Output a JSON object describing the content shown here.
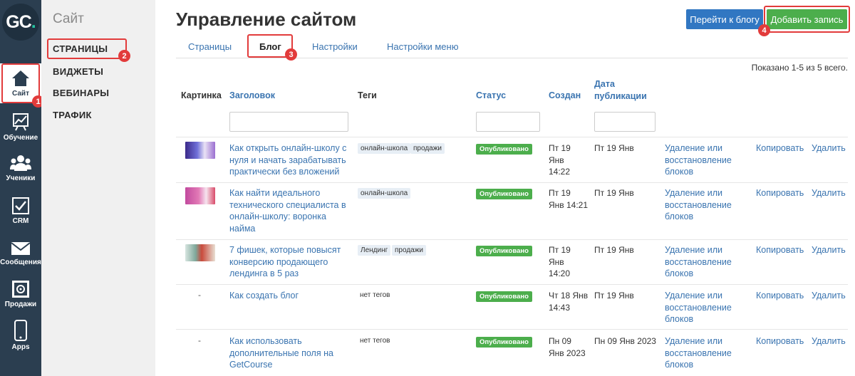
{
  "rail": {
    "logo_main": "GC",
    "logo_dot": ".",
    "items": [
      {
        "label": "Сайт",
        "icon": "home-icon"
      },
      {
        "label": "Обучение",
        "icon": "chart-icon"
      },
      {
        "label": "Ученики",
        "icon": "users-icon"
      },
      {
        "label": "CRM",
        "icon": "checkbox-icon"
      },
      {
        "label": "Сообщения",
        "icon": "envelope-icon"
      },
      {
        "label": "Продажи",
        "icon": "safe-icon"
      },
      {
        "label": "Apps",
        "icon": "phone-icon"
      }
    ]
  },
  "submenu": {
    "title": "Сайт",
    "items": [
      "СТРАНИЦЫ",
      "ВИДЖЕТЫ",
      "ВЕБИНАРЫ",
      "ТРАФИК"
    ]
  },
  "badges": [
    "1",
    "2",
    "3",
    "4"
  ],
  "header": {
    "title": "Управление сайтом",
    "btn_blog": "Перейти к блогу",
    "btn_add": "Добавить запись"
  },
  "tabs": [
    "Страницы",
    "Блог",
    "Настройки",
    "Настройки меню"
  ],
  "summary": "Показано 1-5 из 5 всего.",
  "table": {
    "columns": {
      "image": "Картинка",
      "title": "Заголовок",
      "tags": "Теги",
      "status": "Статус",
      "created": "Создан",
      "pub_line1": "Дата",
      "pub_line2": "публикации"
    },
    "empty_thumb": "-",
    "rows": [
      {
        "title": [
          "Как открыть онлайн-школу с",
          "нуля и начать зарабатывать",
          "практически без вложений"
        ],
        "tags": [
          "онлайн-школа",
          "продажи"
        ],
        "status": "Опубликовано",
        "created": [
          "Пт 19",
          "Янв",
          "14:22"
        ],
        "published": "Пт 19 Янв",
        "restore": [
          "Удаление или",
          "восстановление",
          "блоков"
        ],
        "copy": "Копировать",
        "delete": "Удалить"
      },
      {
        "title": [
          "Как найти идеального",
          "технического специалиста в",
          "онлайн-школу: воронка",
          "найма"
        ],
        "tags": [
          "онлайн-школа"
        ],
        "status": "Опубликовано",
        "created": [
          "Пт 19",
          "Янв 14:21"
        ],
        "published": "Пт 19 Янв",
        "restore": [
          "Удаление или",
          "восстановление",
          "блоков"
        ],
        "copy": "Копировать",
        "delete": "Удалить"
      },
      {
        "title": [
          "7 фишек, которые повысят",
          "конверсию продающего",
          "лендинга в 5 раз"
        ],
        "tags": [
          "Лендинг",
          "продажи"
        ],
        "status": "Опубликовано",
        "created": [
          "Пт 19",
          "Янв",
          "14:20"
        ],
        "published": "Пт 19 Янв",
        "restore": [
          "Удаление или",
          "восстановление",
          "блоков"
        ],
        "copy": "Копировать",
        "delete": "Удалить"
      },
      {
        "title": [
          "Как создать блог"
        ],
        "notags": "нет тегов",
        "status": "Опубликовано",
        "created": [
          "Чт 18 Янв",
          "14:43"
        ],
        "published": "Пт 19 Янв",
        "restore": [
          "Удаление или",
          "восстановление",
          "блоков"
        ],
        "copy": "Копировать",
        "delete": "Удалить"
      },
      {
        "title": [
          "Как использовать",
          "дополнительные поля на",
          "GetCourse"
        ],
        "notags": "нет тегов",
        "status": "Опубликовано",
        "created": [
          "Пн 09",
          "Янв 2023"
        ],
        "published": "Пн 09 Янв 2023",
        "restore": [
          "Удаление или",
          "восстановление",
          "блоков"
        ],
        "copy": "Копировать",
        "delete": "Удалить"
      }
    ]
  },
  "colors": {
    "rail": "#2b3e50",
    "accent_link": "#3a74b0",
    "primary_button": "#3177c2",
    "success": "#4cae4c",
    "highlight": "#e23b3b"
  }
}
